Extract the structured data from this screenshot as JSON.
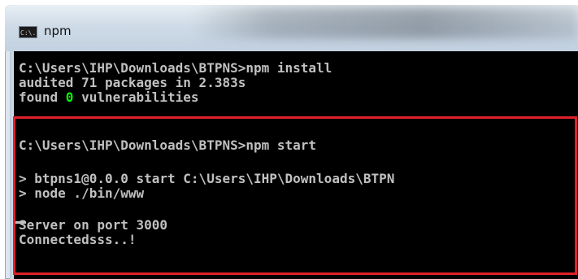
{
  "window": {
    "title": "npm",
    "icon_text": "C:\\."
  },
  "console": {
    "line1_prompt": "C:\\Users\\IHP\\Downloads\\BTPNS>npm install",
    "line2": "audited 71 packages in 2.383s",
    "line3_found": "found ",
    "line3_zero": "0",
    "line3_rest": " vulnerabilities",
    "line4_prompt": "C:\\Users\\IHP\\Downloads\\BTPNS>npm start",
    "line5": "> btpns1@0.0.0 start C:\\Users\\IHP\\Downloads\\BTPN",
    "line6": "> node ./bin/www",
    "line7": "Server on port 3000",
    "line8": "Connectedsss..!"
  },
  "colors": {
    "console_bg": "#000000",
    "console_text": "#c0c0c0",
    "highlight_zero": "#00ff00",
    "annotation_box": "#e0202a"
  }
}
